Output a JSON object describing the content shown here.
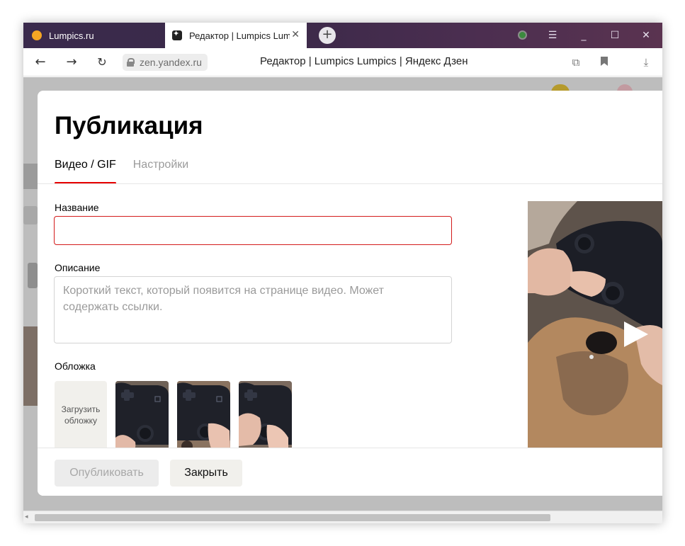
{
  "browser": {
    "tabs": [
      {
        "title": "Lumpics.ru",
        "active": false
      },
      {
        "title": "Редактор | Lumpics Lumpics | Яндекс Дзен",
        "active": true
      }
    ],
    "new_tab_symbol": "+",
    "url": "zen.yandex.ru",
    "page_title": "Редактор | Lumpics Lumpics | Яндекс Дзен",
    "icons": [
      "back-arrow-icon",
      "forward-arrow-icon",
      "reload-icon",
      "lock-icon",
      "tab-manager-icon",
      "bookmark-icon",
      "download-icon",
      "menu-icon",
      "minimize-icon",
      "maximize-icon",
      "close-icon",
      "extension-icon"
    ]
  },
  "modal": {
    "title": "Публикация",
    "tabs": [
      {
        "label": "Видео / GIF",
        "active": true
      },
      {
        "label": "Настройки",
        "active": false
      }
    ],
    "name_label": "Название",
    "name_value": "",
    "description_label": "Описание",
    "description_placeholder": "Короткий текст, который появится на странице видео. Может содержать ссылки.",
    "cover_label": "Обложка",
    "cover_upload_label": "Загрузить обложку",
    "publish_label": "Опубликовать",
    "close_label": "Закрыть"
  },
  "colors": {
    "accent": "#e60000",
    "error_border": "#d31a1a",
    "tab_strip": "#3b2949"
  }
}
